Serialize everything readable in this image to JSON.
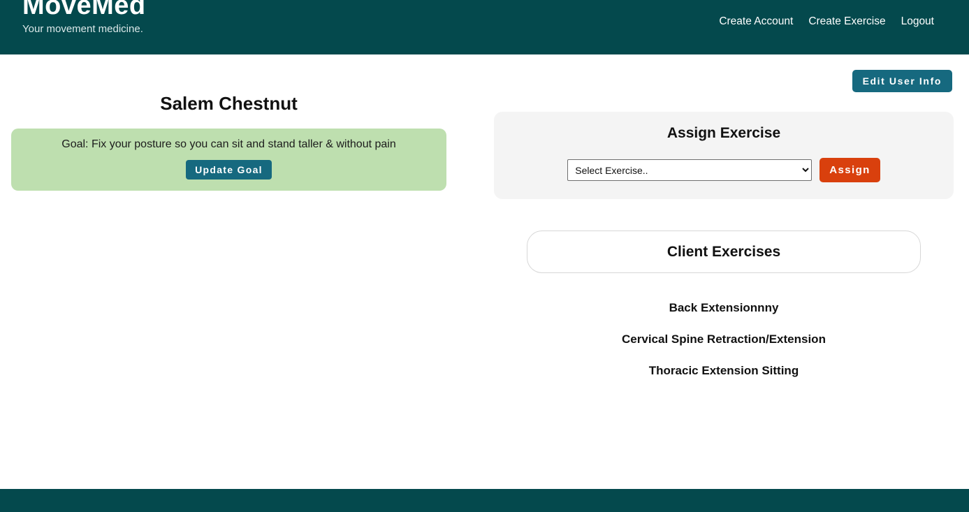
{
  "header": {
    "logo": "MoveMed",
    "tagline": "Your movement medicine.",
    "background_color": "#04494d",
    "nav": [
      {
        "label": "Create Account",
        "name": "nav-create-account"
      },
      {
        "label": "Create Exercise",
        "name": "nav-create-exercise"
      },
      {
        "label": "Logout",
        "name": "nav-logout"
      }
    ]
  },
  "toolbar": {
    "edit_user_label": "Edit User Info",
    "edit_user_color": "#16697f"
  },
  "client": {
    "name": "Salem Chestnut",
    "goal_text": "Goal: Fix your posture so you can sit and stand taller & without pain",
    "update_goal_label": "Update Goal",
    "goal_card_color": "#bedfaf"
  },
  "assign": {
    "title": "Assign Exercise",
    "select_value": "Select Exercise..",
    "select_placeholder": "Select Exercise..",
    "select_options": [
      "Select Exercise.."
    ],
    "assign_label": "Assign",
    "assign_color": "#d9400d",
    "dropdown_icon": "chevron-down-icon"
  },
  "client_exercises": {
    "title": "Client Exercises",
    "items": [
      "Back Extensionnny",
      "Cervical Spine Retraction/Extension",
      "Thoracic Extension Sitting"
    ]
  },
  "footer": {
    "background_color": "#04494d"
  }
}
